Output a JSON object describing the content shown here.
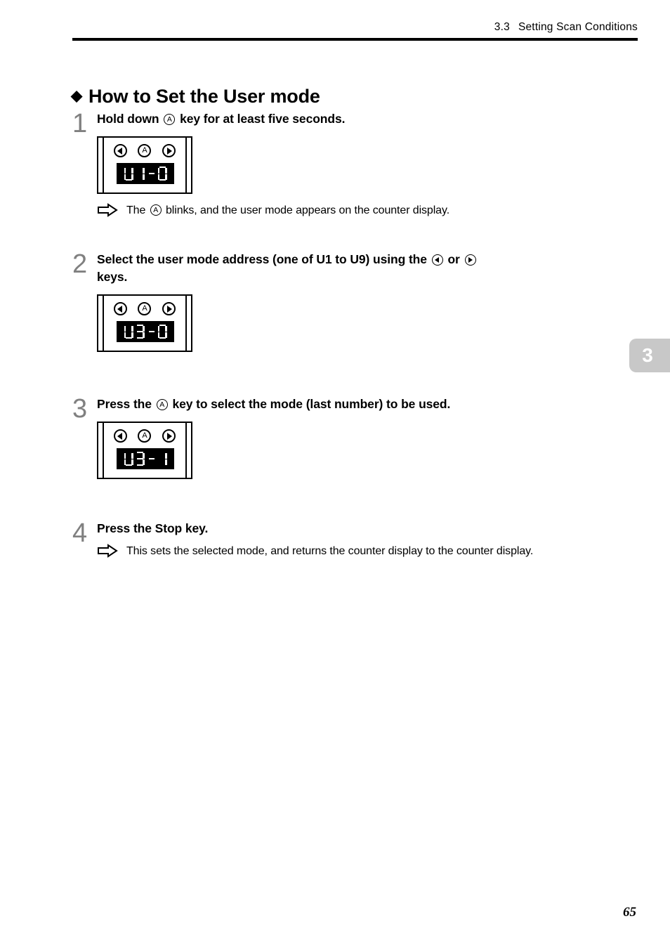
{
  "header": {
    "section_number": "3.3",
    "section_title": "Setting Scan Conditions"
  },
  "title": {
    "bullet": "◆",
    "text": "How to Set the User mode"
  },
  "chapter_tab": {
    "label": "3",
    "color": "#c8c8c8"
  },
  "folio": {
    "page_number": "65"
  },
  "icons": {
    "left_key": "◀",
    "right_key": "▶",
    "a_key": "A",
    "note_arrow": "⇨"
  },
  "steps": [
    {
      "number": "1",
      "head_part1": "Hold down",
      "head_key": "A",
      "head_part2": "key for at least five seconds.",
      "figure": {
        "keys": [
          "left-arrow-key",
          "a-key",
          "right-arrow-key"
        ],
        "display_value": "U1-0",
        "display_chars": [
          "U",
          "1",
          "-",
          "0"
        ]
      },
      "note": "The Ⓐ blinks, and the user mode appears on the counter display.",
      "note_part1": "The",
      "note_key": "A",
      "note_part2": "blinks, and the user mode appears on the counter display."
    },
    {
      "number": "2",
      "head_part1": "Select the user mode address (one of U1 to U9) using the",
      "head_key_left": "◀",
      "head_mid": "or",
      "head_key_right": "▶",
      "head_part2": "keys.",
      "figure": {
        "keys": [
          "left-arrow-key",
          "a-key",
          "right-arrow-key"
        ],
        "display_value": "U3-0",
        "display_chars": [
          "U",
          "3",
          "-",
          "0"
        ]
      }
    },
    {
      "number": "3",
      "head_part1": "Press the",
      "head_key": "A",
      "head_part2": "key to select the mode (last number) to be used.",
      "figure": {
        "keys": [
          "left-arrow-key",
          "a-key",
          "right-arrow-key"
        ],
        "display_value": "U3-1",
        "display_chars": [
          "U",
          "3",
          "-",
          "1"
        ]
      }
    },
    {
      "number": "4",
      "head_text": "Press the Stop key.",
      "note": "This sets the selected mode, and returns the counter display to the counter display."
    }
  ]
}
